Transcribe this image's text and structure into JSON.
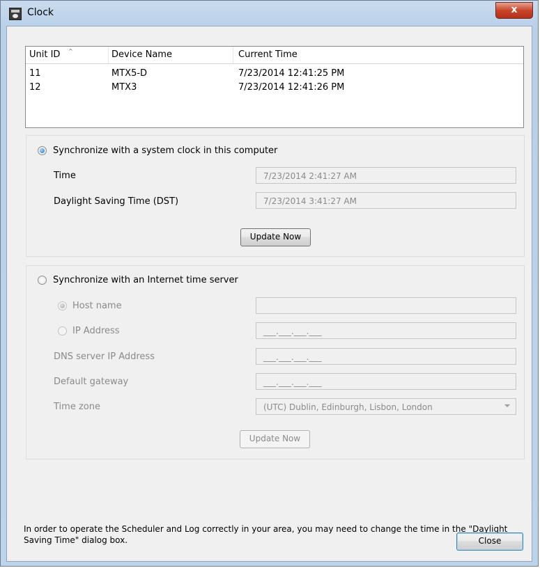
{
  "window": {
    "title": "Clock",
    "close_glyph": "x"
  },
  "devices": {
    "columns": [
      "Unit ID",
      "Device Name",
      "Current Time"
    ],
    "sort_indicator": "^",
    "rows": [
      [
        "11",
        "MTX5-D",
        "7/23/2014 12:41:25 PM"
      ],
      [
        "12",
        "MTX3",
        "7/23/2014 12:41:26 PM"
      ]
    ]
  },
  "system_clock": {
    "radio_label": "Synchronize with a system clock in this computer",
    "selected": true,
    "time_label": "Time",
    "time_value": "7/23/2014 2:41:27 AM",
    "dst_label": "Daylight Saving Time (DST)",
    "dst_value": "7/23/2014 3:41:27 AM",
    "update_label": "Update Now"
  },
  "internet": {
    "radio_label": "Synchronize with an Internet time server",
    "selected": false,
    "host_label": "Host name",
    "host_value": "",
    "ip_label": "IP Address",
    "ip_value": "___.___.___.___",
    "dns_label": "DNS server IP Address",
    "dns_value": "___.___.___.___",
    "gateway_label": "Default gateway",
    "gateway_value": "___.___.___.___",
    "timezone_label": "Time zone",
    "timezone_value": "(UTC) Dublin, Edinburgh, Lisbon, London",
    "update_label": "Update Now"
  },
  "note": "In order to operate the Scheduler and Log correctly in your area, you may need to change the time in the \"Daylight Saving Time\" dialog box.",
  "close_label": "Close",
  "colors": {
    "title_close": "#c9462c",
    "radio_selected": "#1e6eb8",
    "default_button_border": "#3c7fb1"
  }
}
